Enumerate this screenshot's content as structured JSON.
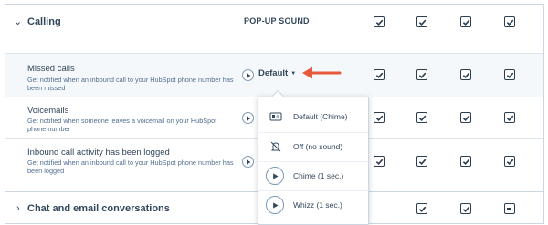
{
  "sections": {
    "calling": {
      "title": "Calling",
      "column_header": "POP-UP SOUND"
    },
    "chat": {
      "title": "Chat and email conversations"
    }
  },
  "rows": [
    {
      "title": "Missed calls",
      "description": "Get notified when an inbound call to your HubSpot phone number has been missed"
    },
    {
      "title": "Voicemails",
      "description": "Get notified when someone leaves a voicemail on your HubSpot phone number"
    },
    {
      "title": "Inbound call activity has been logged",
      "description": "Get notified when an inbound call to your HubSpot phone number has been logged"
    }
  ],
  "sound_select": {
    "value": "Default"
  },
  "sound_menu": [
    {
      "label": "Default (Chime)",
      "icon": "default-sound-icon"
    },
    {
      "label": "Off (no sound)",
      "icon": "sound-off-icon"
    },
    {
      "label": "Chime (1 sec.)",
      "icon": "play-icon"
    },
    {
      "label": "Whizz (1 sec.)",
      "icon": "play-icon"
    }
  ],
  "colors": {
    "accent_arrow": "#e8583b",
    "text": "#33475b",
    "border": "#cbd6e2"
  }
}
